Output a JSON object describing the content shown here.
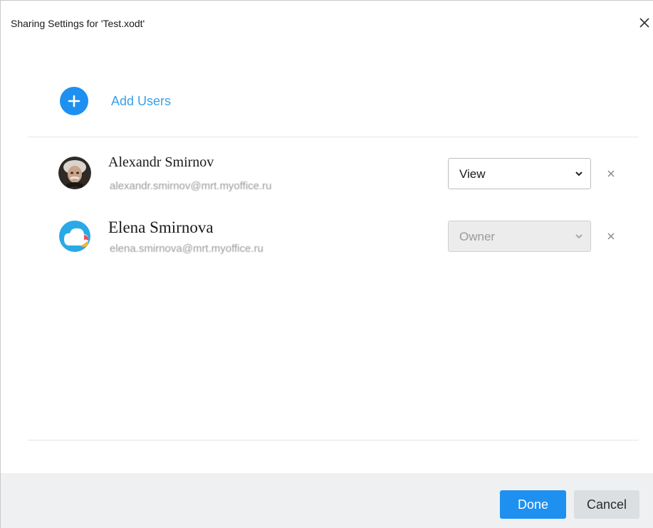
{
  "dialog": {
    "title": "Sharing Settings for 'Test.xodt'",
    "close_icon": "close-icon"
  },
  "add_users": {
    "label": "Add Users",
    "icon": "plus-icon",
    "color": "#1e90f0"
  },
  "users": [
    {
      "name": "Alexandr Smirnov",
      "email": "alexandr.smirnov@mrt.myoffice.ru",
      "role": "View",
      "role_enabled": true,
      "avatar": "photo-avatar"
    },
    {
      "name": "Elena Smirnova",
      "email": "elena.smirnova@mrt.myoffice.ru",
      "role": "Owner",
      "role_enabled": false,
      "avatar": "cloud-avatar"
    }
  ],
  "footer": {
    "done_label": "Done",
    "cancel_label": "Cancel",
    "accent": "#1e90f0"
  }
}
